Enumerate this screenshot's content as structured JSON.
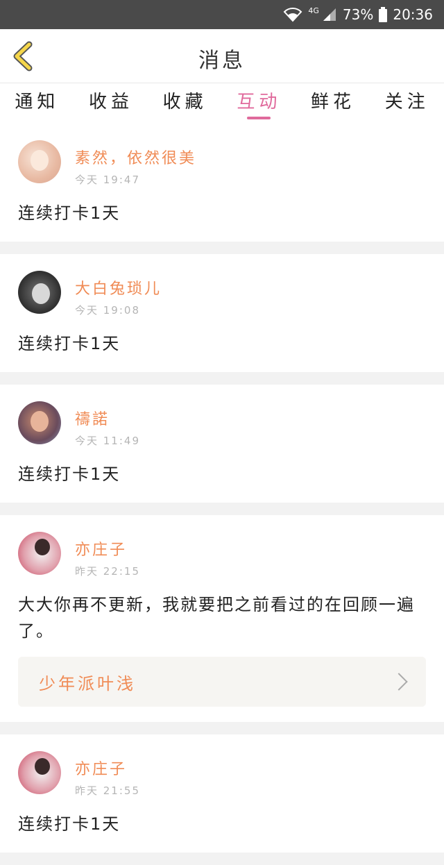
{
  "status_bar": {
    "network": "4G",
    "battery": "73%",
    "time": "20:36"
  },
  "header": {
    "title": "消息"
  },
  "tabs": [
    {
      "label": "通知",
      "active": false
    },
    {
      "label": "收益",
      "active": false
    },
    {
      "label": "收藏",
      "active": false
    },
    {
      "label": "互动",
      "active": true
    },
    {
      "label": "鲜花",
      "active": false
    },
    {
      "label": "关注",
      "active": false
    }
  ],
  "colors": {
    "accent": "#e06a9c",
    "username": "#f08b55"
  },
  "messages": [
    {
      "username": "素然，依然很美",
      "time": "今天  19:47",
      "content": "连续打卡1天"
    },
    {
      "username": "大白兔琐儿",
      "time": "今天  19:08",
      "content": "连续打卡1天"
    },
    {
      "username": "禱諾",
      "time": "今天  11:49",
      "content": "连续打卡1天"
    },
    {
      "username": "亦庄子",
      "time": "昨天  22:15",
      "content": "大大你再不更新，我就要把之前看过的在回顾一遍了。",
      "link": "少年派叶浅"
    },
    {
      "username": "亦庄子",
      "time": "昨天  21:55",
      "content": "连续打卡1天"
    }
  ]
}
